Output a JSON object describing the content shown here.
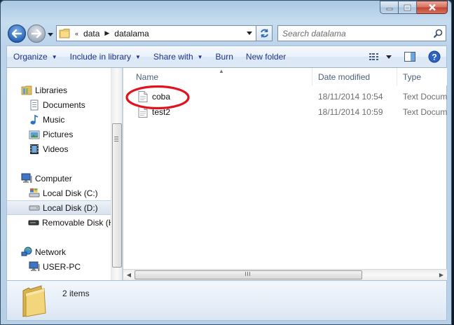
{
  "window": {
    "caption": {
      "minimize": "minimize-icon",
      "maximize": "maximize-icon",
      "close": "close-icon"
    }
  },
  "address": {
    "overflow": "«",
    "segments": [
      "data",
      "datalama"
    ]
  },
  "search": {
    "placeholder": "Search datalama"
  },
  "toolbar": {
    "organize": "Organize",
    "include_in_library": "Include in library",
    "share_with": "Share with",
    "burn": "Burn",
    "new_folder": "New folder"
  },
  "nav": {
    "libraries": {
      "label": "Libraries",
      "items": [
        "Documents",
        "Music",
        "Pictures",
        "Videos"
      ]
    },
    "computer": {
      "label": "Computer",
      "items": [
        "Local Disk (C:)",
        "Local Disk (D:)",
        "Removable Disk (H"
      ]
    },
    "network": {
      "label": "Network",
      "items": [
        "USER-PC"
      ]
    }
  },
  "columns": {
    "name": "Name",
    "date": "Date modified",
    "type": "Type"
  },
  "files": [
    {
      "name": "coba",
      "date": "18/11/2014 10:54",
      "type": "Text Docum"
    },
    {
      "name": "test2",
      "date": "18/11/2014 10:59",
      "type": "Text Docum"
    }
  ],
  "status": {
    "item_count": "2 items"
  },
  "colors": {
    "accent": "#1e3287",
    "annotation": "#e0141e",
    "selection": "#d7e1ee"
  }
}
